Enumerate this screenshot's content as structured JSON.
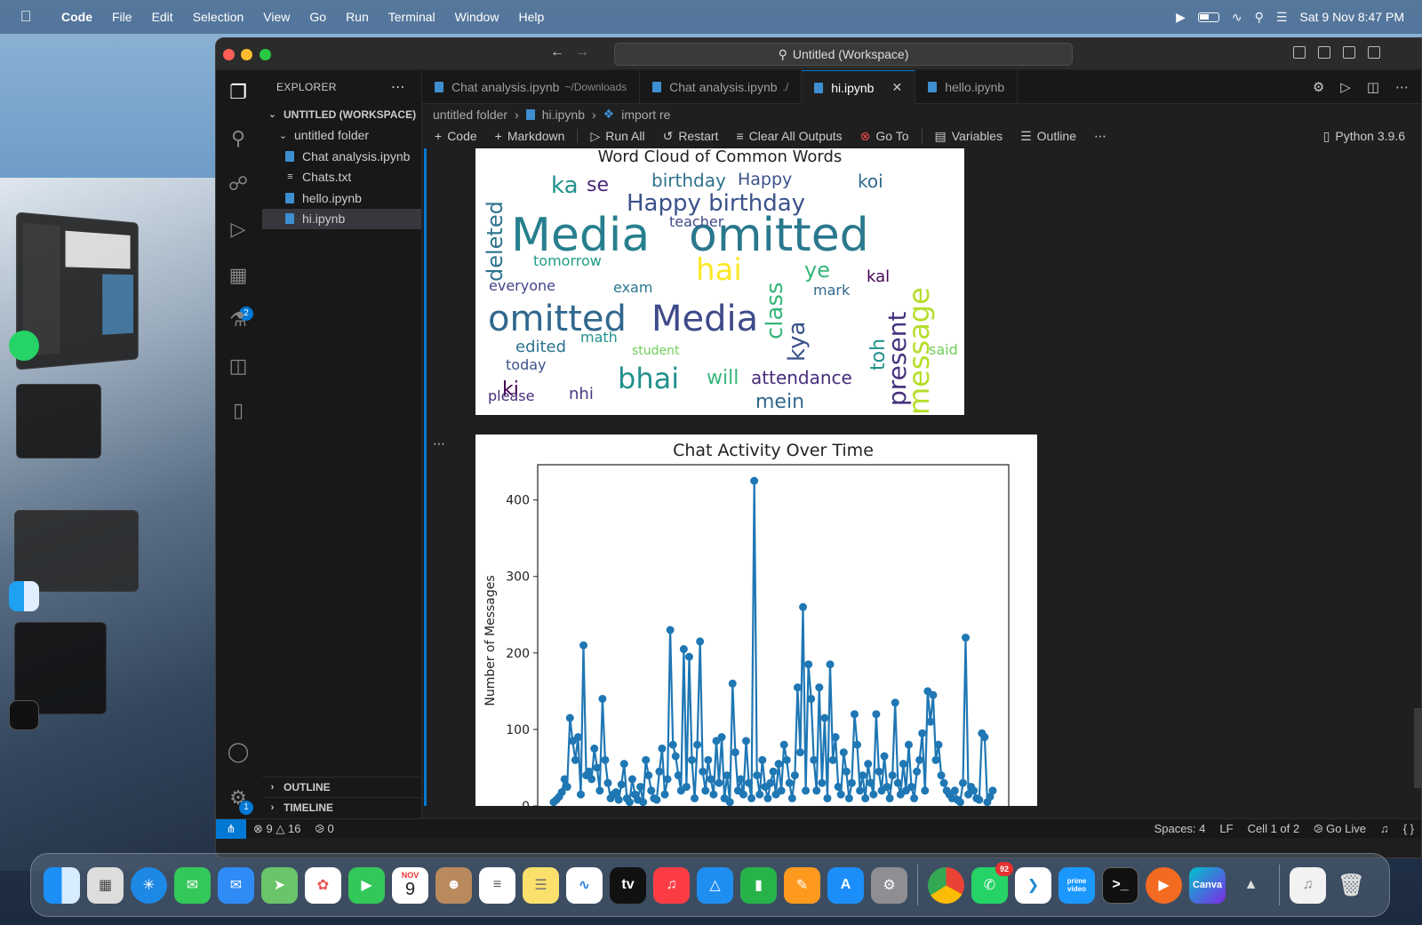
{
  "menubar": {
    "items": [
      "Code",
      "File",
      "Edit",
      "Selection",
      "View",
      "Go",
      "Run",
      "Terminal",
      "Window",
      "Help"
    ],
    "clock": "Sat 9 Nov  8:47 PM"
  },
  "window": {
    "command_center": "Untitled (Workspace)"
  },
  "activity_badges": {
    "extensions": "2",
    "settings": "1"
  },
  "explorer": {
    "title": "EXPLORER",
    "workspace": "UNTITLED (WORKSPACE)",
    "folder": "untitled folder",
    "files": [
      "Chat analysis.ipynb",
      "Chats.txt",
      "hello.ipynb",
      "hi.ipynb"
    ],
    "outline": "OUTLINE",
    "timeline": "TIMELINE"
  },
  "tabs": [
    {
      "label": "Chat analysis.ipynb",
      "desc": "~/Downloads"
    },
    {
      "label": "Chat analysis.ipynb",
      "desc": "./"
    },
    {
      "label": "hi.ipynb",
      "desc": ""
    },
    {
      "label": "hello.ipynb",
      "desc": ""
    }
  ],
  "breadcrumb": [
    "untitled folder",
    "hi.ipynb",
    "import re"
  ],
  "toolbar": {
    "code": "Code",
    "markdown": "Markdown",
    "run_all": "Run All",
    "restart": "Restart",
    "clear": "Clear All Outputs",
    "goto": "Go To",
    "variables": "Variables",
    "outline": "Outline",
    "kernel": "Python 3.9.6"
  },
  "wordcloud": {
    "title": "Word Cloud of Common Words",
    "words": [
      {
        "t": "Media",
        "c": "#277f8e"
      },
      {
        "t": "omitted",
        "c": "#2a788e"
      },
      {
        "t": "omitted",
        "c": "#31688e"
      },
      {
        "t": "Media",
        "c": "#3e4a89"
      },
      {
        "t": "Happy birthday",
        "c": "#3b528b"
      },
      {
        "t": "hai",
        "c": "#fde725"
      },
      {
        "t": "bhai",
        "c": "#21918c"
      },
      {
        "t": "message",
        "c": "#b5de2b"
      },
      {
        "t": "present",
        "c": "#46327e"
      },
      {
        "t": "deleted",
        "c": "#2c728e"
      },
      {
        "t": "kya",
        "c": "#3b528b"
      },
      {
        "t": "class",
        "c": "#35b779"
      },
      {
        "t": "attendance",
        "c": "#472d7b"
      },
      {
        "t": "ki",
        "c": "#440154"
      },
      {
        "t": "nhi",
        "c": "#443983"
      },
      {
        "t": "mein",
        "c": "#31688e"
      },
      {
        "t": "birthday",
        "c": "#2c728e"
      },
      {
        "t": "Happy",
        "c": "#3b528b"
      },
      {
        "t": "ka",
        "c": "#21918c"
      },
      {
        "t": "se",
        "c": "#482878"
      },
      {
        "t": "koi",
        "c": "#31688e"
      },
      {
        "t": "ye",
        "c": "#35b779"
      },
      {
        "t": "tomorrow",
        "c": "#1f9e89"
      },
      {
        "t": "everyone",
        "c": "#414487"
      },
      {
        "t": "exam",
        "c": "#2a788e"
      },
      {
        "t": "teacher",
        "c": "#3e4a89"
      },
      {
        "t": "edited",
        "c": "#2c728e"
      },
      {
        "t": "math",
        "c": "#21918c"
      },
      {
        "t": "today",
        "c": "#3b528b"
      },
      {
        "t": "please",
        "c": "#472d7b"
      },
      {
        "t": "will",
        "c": "#35b779"
      },
      {
        "t": "student",
        "c": "#6ece58"
      },
      {
        "t": "toh",
        "c": "#21918c"
      },
      {
        "t": "kal",
        "c": "#440154"
      },
      {
        "t": "mark",
        "c": "#31688e"
      },
      {
        "t": "said",
        "c": "#6ece58"
      }
    ]
  },
  "chart_data": {
    "type": "line",
    "title": "Chat Activity Over Time",
    "xlabel": "",
    "ylabel": "Number of Messages",
    "ylim": [
      0,
      460
    ],
    "yticks": [
      0,
      100,
      200,
      300,
      400
    ],
    "color": "#1f77b4",
    "marker": "o",
    "y": [
      5,
      8,
      12,
      18,
      35,
      25,
      115,
      85,
      60,
      90,
      15,
      210,
      40,
      45,
      35,
      75,
      50,
      20,
      140,
      60,
      30,
      10,
      15,
      18,
      8,
      28,
      55,
      10,
      5,
      35,
      15,
      8,
      25,
      5,
      60,
      40,
      20,
      10,
      8,
      45,
      75,
      15,
      35,
      230,
      80,
      65,
      40,
      20,
      205,
      25,
      195,
      60,
      10,
      80,
      215,
      45,
      20,
      60,
      35,
      15,
      85,
      30,
      90,
      10,
      40,
      5,
      160,
      70,
      20,
      35,
      15,
      85,
      30,
      10,
      425,
      40,
      15,
      60,
      25,
      10,
      30,
      45,
      15,
      55,
      20,
      80,
      60,
      30,
      10,
      40,
      155,
      70,
      260,
      20,
      185,
      140,
      60,
      20,
      155,
      30,
      115,
      10,
      185,
      60,
      90,
      25,
      15,
      70,
      45,
      10,
      30,
      120,
      80,
      20,
      40,
      10,
      55,
      30,
      15,
      120,
      45,
      20,
      65,
      25,
      10,
      40,
      135,
      30,
      15,
      55,
      20,
      80,
      25,
      10,
      45,
      60,
      95,
      20,
      150,
      110,
      145,
      60,
      80,
      40,
      30,
      20,
      15,
      10,
      20,
      8,
      5,
      30,
      220,
      15,
      25,
      20,
      10,
      8,
      95,
      90,
      5,
      12,
      20
    ],
    "grid": false
  },
  "statusbar": {
    "errors": "9",
    "warnings": "16",
    "ports": "0",
    "spaces": "Spaces: 4",
    "eol": "LF",
    "cell": "Cell 1 of 2",
    "live": "Go Live"
  },
  "dock": {
    "calendar_month": "NOV",
    "calendar_day": "9",
    "whatsapp_badge": "92",
    "prime_label": "prime video",
    "canva_label": "Canva"
  }
}
